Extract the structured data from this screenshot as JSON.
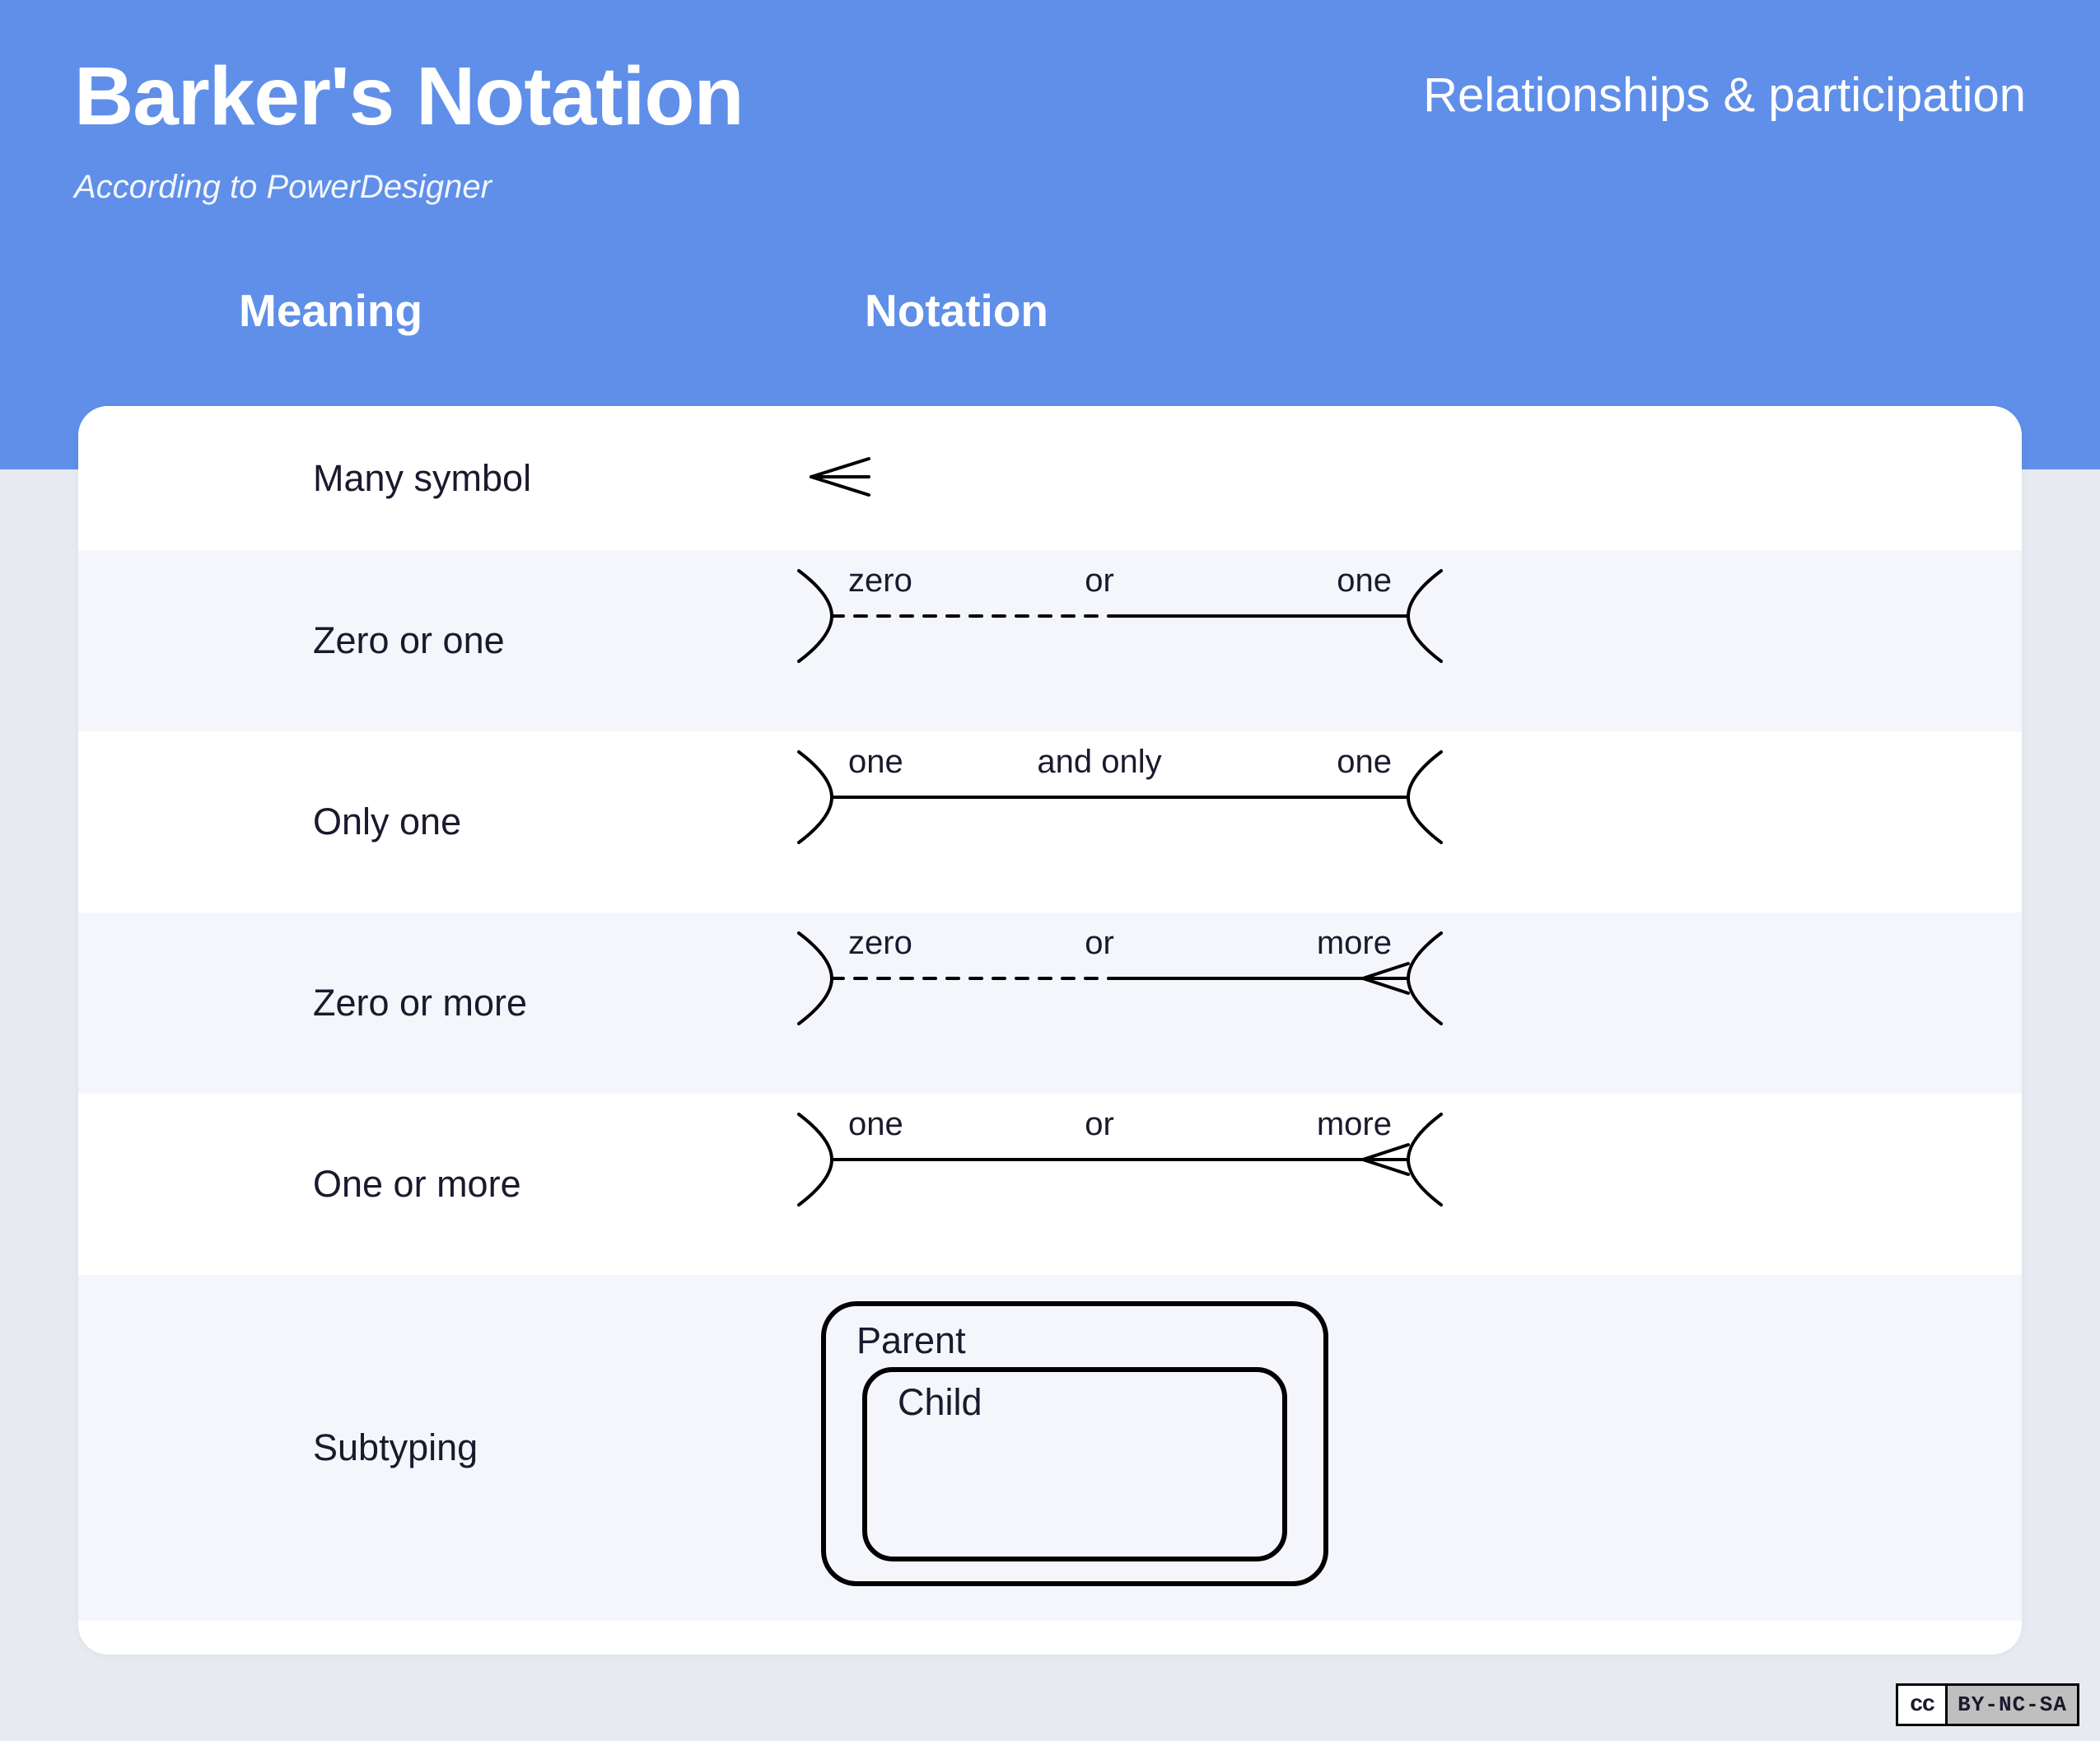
{
  "header": {
    "title": "Barker's Notation",
    "subtitle": "According to PowerDesigner",
    "section": "Relationships & participation"
  },
  "columns": {
    "meaning": "Meaning",
    "notation": "Notation"
  },
  "rows": [
    {
      "meaning": "Many symbol",
      "labels": []
    },
    {
      "meaning": "Zero or one",
      "labels": [
        "zero",
        "or",
        "one"
      ]
    },
    {
      "meaning": "Only one",
      "labels": [
        "one",
        "and only",
        "one"
      ]
    },
    {
      "meaning": "Zero or more",
      "labels": [
        "zero",
        "or",
        "more"
      ]
    },
    {
      "meaning": "One or more",
      "labels": [
        "one",
        "or",
        "more"
      ]
    },
    {
      "meaning": "Subtyping",
      "labels": [
        "Parent",
        "Child"
      ]
    }
  ],
  "license": {
    "logo": "cc",
    "text": "BY-NC-SA"
  }
}
